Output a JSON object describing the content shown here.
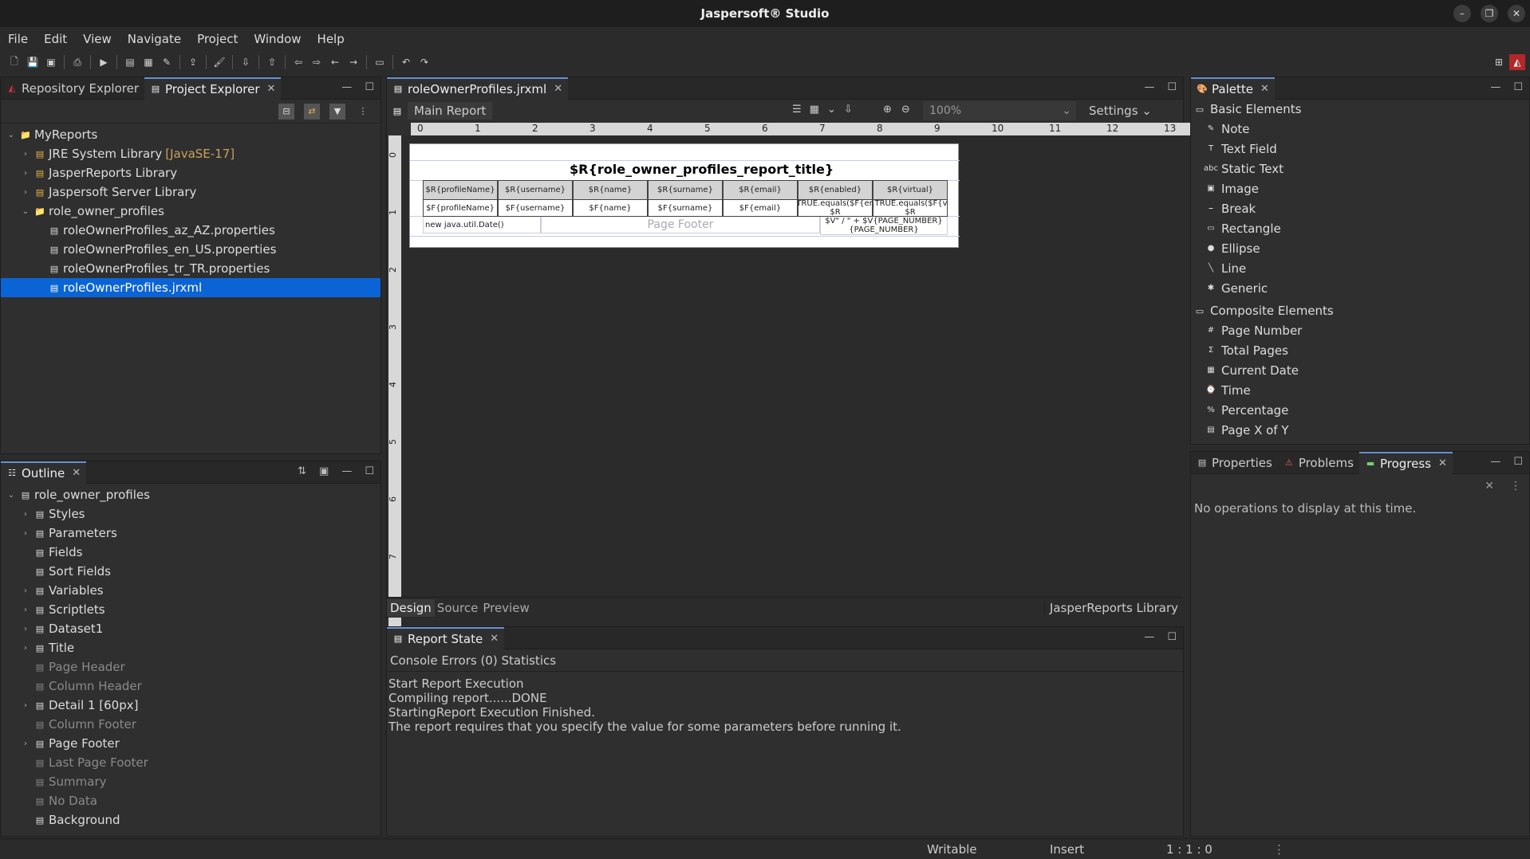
{
  "window": {
    "title": "Jaspersoft® Studio"
  },
  "menu": [
    "File",
    "Edit",
    "View",
    "Navigate",
    "Project",
    "Window",
    "Help"
  ],
  "left_top": {
    "tabs": [
      {
        "label": "Repository Explorer"
      },
      {
        "label": "Project Explorer"
      }
    ],
    "tree": [
      {
        "label": "MyReports",
        "indent": 0,
        "arrow": "v",
        "icon": "folder"
      },
      {
        "label": "JRE System Library",
        "decor": "[JavaSE-17]",
        "indent": 1,
        "arrow": ">",
        "icon": "lib"
      },
      {
        "label": "JasperReports Library",
        "indent": 1,
        "arrow": ">",
        "icon": "lib"
      },
      {
        "label": "Jaspersoft Server Library",
        "indent": 1,
        "arrow": ">",
        "icon": "lib"
      },
      {
        "label": "role_owner_profiles",
        "indent": 1,
        "arrow": "v",
        "icon": "folder"
      },
      {
        "label": "roleOwnerProfiles_az_AZ.properties",
        "indent": 2,
        "arrow": "",
        "icon": "file"
      },
      {
        "label": "roleOwnerProfiles_en_US.properties",
        "indent": 2,
        "arrow": "",
        "icon": "file"
      },
      {
        "label": "roleOwnerProfiles_tr_TR.properties",
        "indent": 2,
        "arrow": "",
        "icon": "file"
      },
      {
        "label": "roleOwnerProfiles.jrxml",
        "indent": 2,
        "arrow": "",
        "icon": "jrxml",
        "selected": true
      }
    ]
  },
  "outline": {
    "tab": "Outline",
    "tree": [
      {
        "label": "role_owner_profiles",
        "indent": 0,
        "arrow": "v"
      },
      {
        "label": "Styles",
        "indent": 1,
        "arrow": ">"
      },
      {
        "label": "Parameters",
        "indent": 1,
        "arrow": ">"
      },
      {
        "label": "Fields",
        "indent": 1,
        "arrow": ""
      },
      {
        "label": "Sort Fields",
        "indent": 1,
        "arrow": ""
      },
      {
        "label": "Variables",
        "indent": 1,
        "arrow": ">"
      },
      {
        "label": "Scriptlets",
        "indent": 1,
        "arrow": ">"
      },
      {
        "label": "Dataset1",
        "indent": 1,
        "arrow": ">"
      },
      {
        "label": "Title",
        "indent": 1,
        "arrow": ">",
        "bright": true
      },
      {
        "label": "Page Header",
        "indent": 1,
        "arrow": "",
        "dim": true
      },
      {
        "label": "Column Header",
        "indent": 1,
        "arrow": "",
        "dim": true
      },
      {
        "label": "Detail 1 [60px]",
        "indent": 1,
        "arrow": ">",
        "bright": true
      },
      {
        "label": "Column Footer",
        "indent": 1,
        "arrow": "",
        "dim": true
      },
      {
        "label": "Page Footer",
        "indent": 1,
        "arrow": ">",
        "bright": true
      },
      {
        "label": "Last Page Footer",
        "indent": 1,
        "arrow": "",
        "dim": true
      },
      {
        "label": "Summary",
        "indent": 1,
        "arrow": "",
        "dim": true
      },
      {
        "label": "No Data",
        "indent": 1,
        "arrow": "",
        "dim": true
      },
      {
        "label": "Background",
        "indent": 1,
        "arrow": "",
        "bright": true
      }
    ]
  },
  "editor": {
    "tab": "roleOwnerProfiles.jrxml",
    "main_report": "Main Report",
    "zoom": "100%",
    "settings": "Settings",
    "ruler": [
      "0",
      "1",
      "2",
      "3",
      "4",
      "5",
      "6",
      "7",
      "8",
      "9",
      "10",
      "11",
      "12",
      "13"
    ],
    "ruler_left": [
      "0",
      "1",
      "2",
      "3",
      "4",
      "5",
      "6",
      "7"
    ],
    "report_title": "$R{role_owner_profiles_report_title}",
    "headers": [
      "$R{profileName}",
      "$R{username}",
      "$R{name}",
      "$R{surname}",
      "$R{email}",
      "$R{enabled}",
      "$R{virtual}"
    ],
    "details": [
      "$F{profileName}",
      "$F{username}",
      "$F{name}",
      "$F{surname}",
      "$F{email}",
      "(Boolean.TRUE.equals($F{enabled}))? $R",
      "(Boolean.TRUE.equals($F{virtual}))? $R"
    ],
    "footer_date": "new java.util.Date()",
    "footer_label": "Page Footer",
    "footer_page": "$V\" / \" + $V{PAGE_NUMBER}{PAGE_NUMBER}",
    "bottom_tabs": [
      "Design",
      "Source",
      "Preview"
    ],
    "library": "JasperReports Library"
  },
  "report_state": {
    "tab": "Report State",
    "subtabs": "Console Errors (0) Statistics",
    "lines": [
      "Start Report Execution",
      "Compiling report......DONE",
      "StartingReport Execution Finished.",
      "The report requires that you specify the value for some parameters before running it."
    ]
  },
  "palette": {
    "tab": "Palette",
    "basic_title": "Basic Elements",
    "basic": [
      "Note",
      "Text Field",
      "Static Text",
      "Image",
      "Break",
      "Rectangle",
      "Ellipse",
      "Line",
      "Generic"
    ],
    "composite_title": "Composite Elements",
    "composite": [
      "Page Number",
      "Total Pages",
      "Current Date",
      "Time",
      "Percentage",
      "Page X of Y"
    ]
  },
  "progress": {
    "tabs": [
      "Properties",
      "Problems",
      "Progress"
    ],
    "message": "No operations to display at this time."
  },
  "status": {
    "writable": "Writable",
    "insert": "Insert",
    "position": "1 : 1 : 0"
  }
}
